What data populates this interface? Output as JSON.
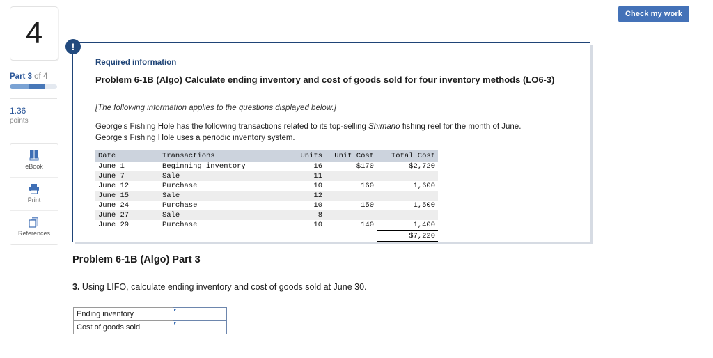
{
  "toolbar": {
    "check_my_work_label": "Check my work"
  },
  "sidebar": {
    "question_number": "4",
    "part_label_bold": "Part 3",
    "part_label_rest": " of 4",
    "points_value": "1.36",
    "points_label": "points",
    "tools": [
      {
        "icon": "ebook-icon",
        "label": "eBook"
      },
      {
        "icon": "printer-icon",
        "label": "Print"
      },
      {
        "icon": "references-icon",
        "label": "References"
      }
    ],
    "progress": {
      "percent_filled": 75,
      "segments": 2
    }
  },
  "required_panel": {
    "alert_icon": "exclamation-icon",
    "alert_glyph": "!",
    "required_label": "Required information",
    "problem_title": "Problem 6-1B (Algo) Calculate ending inventory and cost of goods sold for four inventory methods (LO6-3)",
    "applies_note": "[The following information applies to the questions displayed below.]",
    "intro_line_1_a": "George's Fishing Hole has the following transactions related to its top-selling ",
    "intro_line_1_em": "Shimano",
    "intro_line_1_b": " fishing reel for the month of June.",
    "intro_line_2": "George's Fishing Hole uses a periodic inventory system."
  },
  "transactions_table": {
    "headers": [
      "Date",
      "Transactions",
      "Units",
      "Unit Cost",
      "Total Cost"
    ],
    "rows": [
      {
        "date": "June  1",
        "transaction": "Beginning inventory",
        "units": "16",
        "unit_cost": "$170",
        "total_cost": "$2,720"
      },
      {
        "date": "June  7",
        "transaction": "Sale",
        "units": "11",
        "unit_cost": "",
        "total_cost": ""
      },
      {
        "date": "June 12",
        "transaction": "Purchase",
        "units": "10",
        "unit_cost": "160",
        "total_cost": "1,600"
      },
      {
        "date": "June 15",
        "transaction": "Sale",
        "units": "12",
        "unit_cost": "",
        "total_cost": ""
      },
      {
        "date": "June 24",
        "transaction": "Purchase",
        "units": "10",
        "unit_cost": "150",
        "total_cost": "1,500"
      },
      {
        "date": "June 27",
        "transaction": "Sale",
        "units": "8",
        "unit_cost": "",
        "total_cost": ""
      },
      {
        "date": "June 29",
        "transaction": "Purchase",
        "units": "10",
        "unit_cost": "140",
        "total_cost": "1,400"
      }
    ],
    "total_row": {
      "date": "",
      "transaction": "",
      "units": "",
      "unit_cost": "",
      "total_cost": "$7,220"
    }
  },
  "part_section": {
    "heading": "Problem 6-1B (Algo) Part 3",
    "question_number": "3.",
    "question_text": " Using LIFO, calculate ending inventory and cost of goods sold at June 30.",
    "answer_rows": [
      {
        "label": "Ending inventory",
        "value": "",
        "placeholder": ""
      },
      {
        "label": "Cost of goods sold",
        "value": "",
        "placeholder": ""
      }
    ]
  },
  "colors": {
    "accent_blue": "#4472b8",
    "panel_border_navy": "#1f4477",
    "link_blue": "#2a5699",
    "table_header_gray": "#ccd3dd"
  }
}
